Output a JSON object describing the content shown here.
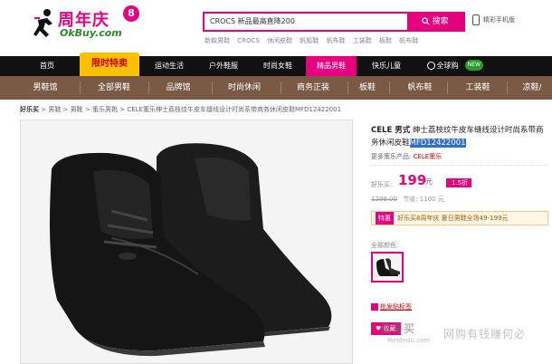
{
  "header": {
    "logo_cn": "周年庆",
    "logo_en": "OkBuy.com",
    "logo_badge": "8",
    "search_value": "CROCS 新品最高直降200",
    "search_button": "搜索",
    "mobile_label": "精彩手机版",
    "hotwords": [
      "新款男鞋",
      "CROCS",
      "休闲皮鞋",
      "帆船鞋",
      "帆布鞋",
      "工装鞋",
      "板鞋",
      "帆布鞋"
    ]
  },
  "nav_primary": [
    "首页",
    "限时特卖",
    "运动生活",
    "户外鞋服",
    "时尚女鞋",
    "精品男鞋",
    "快乐儿童",
    "全球购"
  ],
  "nav_primary_badge": "NEW",
  "nav_secondary": [
    "男鞋馆",
    "全部男鞋",
    "品牌馆",
    "时尚休闲",
    "商务正装",
    "板鞋",
    "帆布鞋",
    "工装鞋",
    "凉鞋/"
  ],
  "breadcrumb": {
    "items": [
      "好乐买",
      "男鞋",
      "男靴",
      "策乐男靴"
    ],
    "current": "CELE策乐绅士荔枝纹牛皮车缝线设计时尚系带商务休闲皮鞋MFD12422001"
  },
  "product": {
    "title_brand": "CELE 男式",
    "title_text": "绅士荔枝纹牛皮车缝线设计时尚系带商务休闲皮鞋",
    "title_sku": "MFD12422001",
    "more_label": "更多策乐产品:",
    "more_link": "CELE策乐",
    "price_label": "好乐买:",
    "price": "199",
    "price_unit": "元",
    "discount": "1.5折",
    "orig_price": "1299.00",
    "save_text": "节省: 1100 元",
    "promo_tag": "特惠",
    "promo_text": "好乐买8周年庆 夏日男鞋全场49-199元",
    "color_label": "全部颜色:",
    "size_link": "批发贴标签",
    "fav_button": "收藏"
  },
  "watermark": {
    "main": "值得买",
    "slogan": "网购有钱赚何必",
    "domain": "Meidedu.com"
  },
  "colors": {
    "brand_pink": "#e4007f",
    "nav_dark": "#111111",
    "nav_brown": "#7a5a45",
    "hot_yellow": "#ffc000"
  }
}
